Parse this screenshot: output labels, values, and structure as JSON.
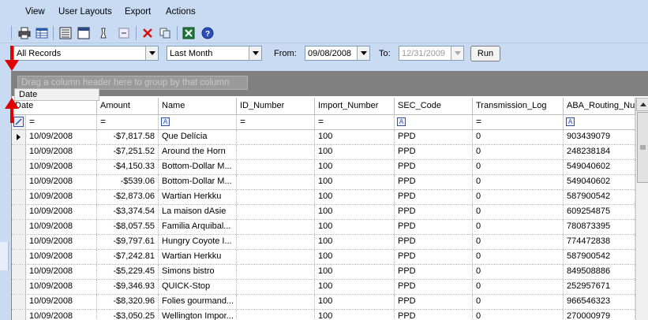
{
  "menu": {
    "items": [
      {
        "label": "View"
      },
      {
        "label": "User Layouts"
      },
      {
        "label": "Export"
      },
      {
        "label": "Actions"
      }
    ]
  },
  "toolbar": {
    "icons": [
      "print-icon",
      "grid-icon",
      "list-icon",
      "window-icon",
      "filter-icon",
      "collapse-icon",
      "delete-icon",
      "copy-icon",
      "excel-icon",
      "help-icon"
    ]
  },
  "filters": {
    "records": "All Records",
    "period": "Last Month",
    "from_label": "From:",
    "from_date": "09/08/2008",
    "to_label": "To:",
    "to_date": "12/31/2009",
    "run_label": "Run"
  },
  "grid": {
    "group_hint": "Drag a column header here to group by that column",
    "drag_tooltip": "Date",
    "columns": [
      "Date",
      "Amount",
      "Name",
      "ID_Number",
      "Import_Number",
      "SEC_Code",
      "Transmission_Log",
      "ABA_Routing_Nu"
    ],
    "filter_ops": [
      "=",
      "=",
      "A",
      "=",
      "=",
      "A",
      "=",
      "A"
    ],
    "rows": [
      [
        "10/09/2008",
        "-$7,817.58",
        "Que Delícia",
        "",
        "100",
        "PPD",
        "0",
        "903439079"
      ],
      [
        "10/09/2008",
        "-$7,251.52",
        "Around the Horn",
        "",
        "100",
        "PPD",
        "0",
        "248238184"
      ],
      [
        "10/09/2008",
        "-$4,150.33",
        "Bottom-Dollar M...",
        "",
        "100",
        "PPD",
        "0",
        "549040602"
      ],
      [
        "10/09/2008",
        "-$539.06",
        "Bottom-Dollar M...",
        "",
        "100",
        "PPD",
        "0",
        "549040602"
      ],
      [
        "10/09/2008",
        "-$2,873.06",
        "Wartian Herkku",
        "",
        "100",
        "PPD",
        "0",
        "587900542"
      ],
      [
        "10/09/2008",
        "-$3,374.54",
        "La maison dAsie",
        "",
        "100",
        "PPD",
        "0",
        "609254875"
      ],
      [
        "10/09/2008",
        "-$8,057.55",
        "Familia Arquibal...",
        "",
        "100",
        "PPD",
        "0",
        "780873395"
      ],
      [
        "10/09/2008",
        "-$9,797.61",
        "Hungry Coyote I...",
        "",
        "100",
        "PPD",
        "0",
        "774472838"
      ],
      [
        "10/09/2008",
        "-$7,242.81",
        "Wartian Herkku",
        "",
        "100",
        "PPD",
        "0",
        "587900542"
      ],
      [
        "10/09/2008",
        "-$5,229.45",
        "Simons bistro",
        "",
        "100",
        "PPD",
        "0",
        "849508886"
      ],
      [
        "10/09/2008",
        "-$9,346.93",
        "QUICK-Stop",
        "",
        "100",
        "PPD",
        "0",
        "252957671"
      ],
      [
        "10/09/2008",
        "-$8,320.96",
        "Folies gourmand...",
        "",
        "100",
        "PPD",
        "0",
        "966546323"
      ],
      [
        "10/09/2008",
        "-$3,050.25",
        "Wellington Impor...",
        "",
        "100",
        "PPD",
        "0",
        "270000979"
      ]
    ]
  }
}
